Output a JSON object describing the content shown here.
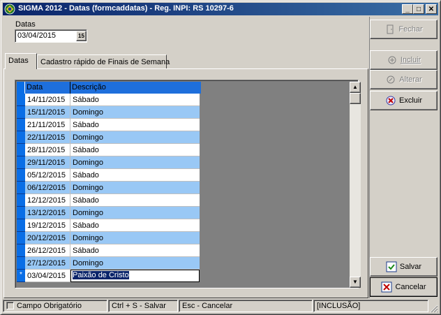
{
  "window": {
    "title": "SIGMA 2012 - Datas  (formcaddatas)  - Reg. INPI: RS 10297-6"
  },
  "form": {
    "datas_label": "Datas",
    "datas_value": "03/04/2015",
    "calendar_glyph": "15"
  },
  "side_buttons": {
    "fechar": "Fechar",
    "incluir": "Incluir",
    "alterar": "Alterar",
    "excluir": "Excluir",
    "salvar": "Salvar",
    "cancelar": "Cancelar"
  },
  "tabs": [
    {
      "label": "Datas"
    },
    {
      "label": "Cadastro rápido de Finais de Semana"
    }
  ],
  "grid": {
    "headers": [
      "Data",
      "Descrição"
    ],
    "rows": [
      {
        "date": "14/11/2015",
        "desc": "Sábado"
      },
      {
        "date": "15/11/2015",
        "desc": "Domingo"
      },
      {
        "date": "21/11/2015",
        "desc": "Sábado"
      },
      {
        "date": "22/11/2015",
        "desc": "Domingo"
      },
      {
        "date": "28/11/2015",
        "desc": "Sábado"
      },
      {
        "date": "29/11/2015",
        "desc": "Domingo"
      },
      {
        "date": "05/12/2015",
        "desc": "Sábado"
      },
      {
        "date": "06/12/2015",
        "desc": "Domingo"
      },
      {
        "date": "12/12/2015",
        "desc": "Sábado"
      },
      {
        "date": "13/12/2015",
        "desc": "Domingo"
      },
      {
        "date": "19/12/2015",
        "desc": "Sábado"
      },
      {
        "date": "20/12/2015",
        "desc": "Domingo"
      },
      {
        "date": "26/12/2015",
        "desc": "Sábado"
      },
      {
        "date": "27/12/2015",
        "desc": "Domingo"
      }
    ],
    "edit_row": {
      "indicator": "*",
      "date": "03/04/2015",
      "desc": "Paixão de Cristo"
    }
  },
  "statusbar": {
    "required": "Campo Obrigatório",
    "save_hint": "Ctrl + S - Salvar",
    "cancel_hint": "Esc - Cancelar",
    "mode": "[INCLUSÃO]"
  }
}
